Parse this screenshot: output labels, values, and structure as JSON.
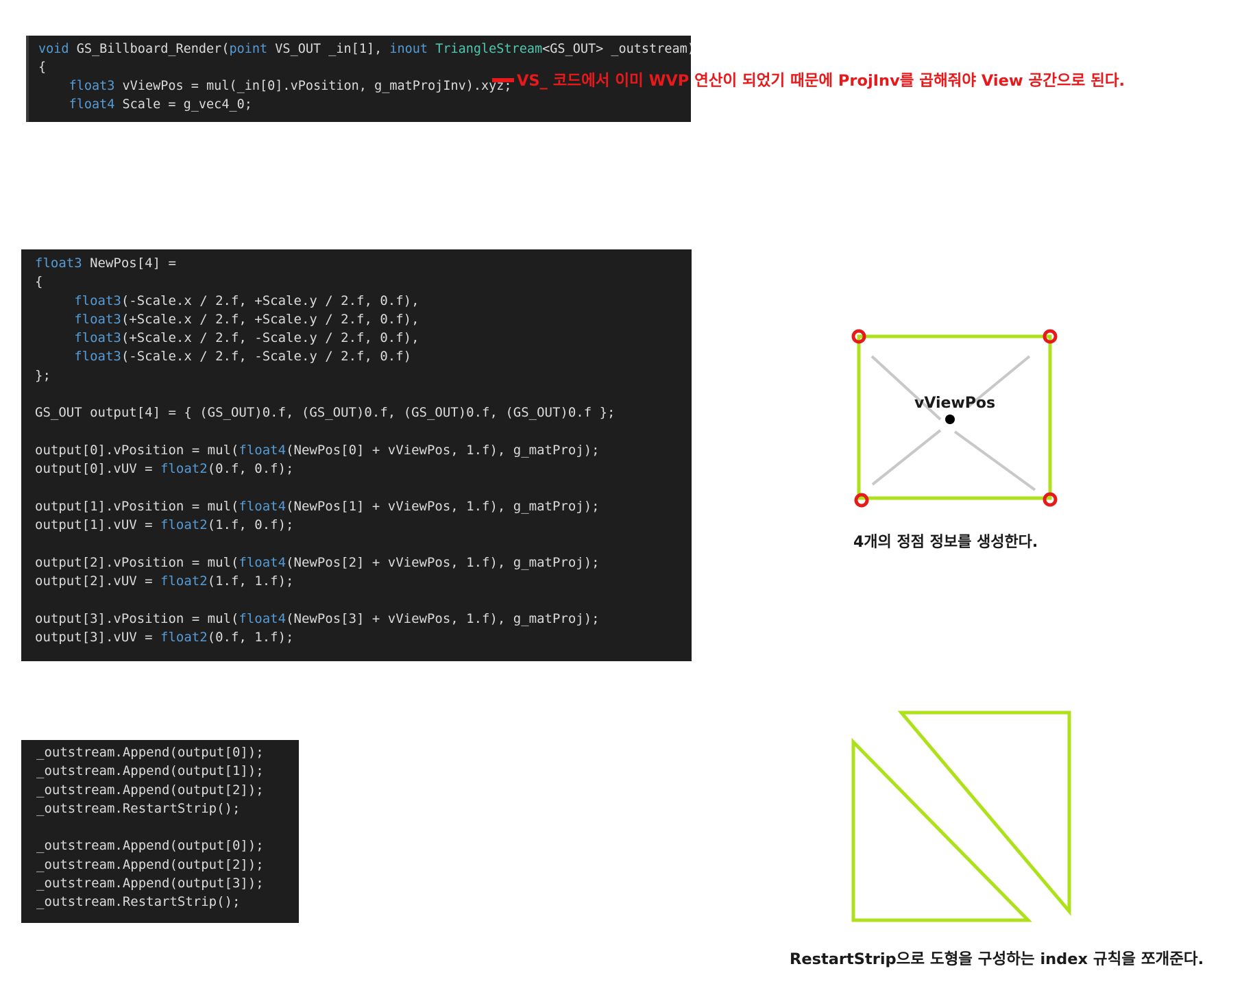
{
  "code_top": {
    "lines": [
      [
        {
          "t": "void ",
          "c": "kw"
        },
        {
          "t": "GS_Billboard_Render(",
          "c": ""
        },
        {
          "t": "point ",
          "c": "kw"
        },
        {
          "t": "VS_OUT _in[1], ",
          "c": ""
        },
        {
          "t": "inout ",
          "c": "kw"
        },
        {
          "t": "TriangleStream",
          "c": "ty"
        },
        {
          "t": "<GS_OUT> _outstream)",
          "c": ""
        }
      ],
      [
        {
          "t": "{",
          "c": ""
        }
      ],
      [
        {
          "t": "    ",
          "c": ""
        },
        {
          "t": "float3 ",
          "c": "kw"
        },
        {
          "t": "vViewPos = mul(_in[0].vPosition, g_matProjInv).xyz;",
          "c": ""
        }
      ],
      [
        {
          "t": "    ",
          "c": ""
        },
        {
          "t": "float4 ",
          "c": "kw"
        },
        {
          "t": "Scale = g_vec4_0;",
          "c": ""
        }
      ]
    ]
  },
  "code_middle": {
    "lines": [
      [
        {
          "t": "float3 ",
          "c": "kw"
        },
        {
          "t": "NewPos[4] =",
          "c": ""
        }
      ],
      [
        {
          "t": "{",
          "c": ""
        }
      ],
      [
        {
          "t": "     ",
          "c": ""
        },
        {
          "t": "float3",
          "c": "kw"
        },
        {
          "t": "(-Scale.x / 2.f, +Scale.y / 2.f, 0.f),",
          "c": ""
        }
      ],
      [
        {
          "t": "     ",
          "c": ""
        },
        {
          "t": "float3",
          "c": "kw"
        },
        {
          "t": "(+Scale.x / 2.f, +Scale.y / 2.f, 0.f),",
          "c": ""
        }
      ],
      [
        {
          "t": "     ",
          "c": ""
        },
        {
          "t": "float3",
          "c": "kw"
        },
        {
          "t": "(+Scale.x / 2.f, -Scale.y / 2.f, 0.f),",
          "c": ""
        }
      ],
      [
        {
          "t": "     ",
          "c": ""
        },
        {
          "t": "float3",
          "c": "kw"
        },
        {
          "t": "(-Scale.x / 2.f, -Scale.y / 2.f, 0.f)",
          "c": ""
        }
      ],
      [
        {
          "t": "};",
          "c": ""
        }
      ],
      [],
      [
        {
          "t": "GS_OUT output[4] = { (GS_OUT)0.f, (GS_OUT)0.f, (GS_OUT)0.f, (GS_OUT)0.f };",
          "c": ""
        }
      ],
      [],
      [
        {
          "t": "output[0].vPosition = mul(",
          "c": ""
        },
        {
          "t": "float4",
          "c": "kw"
        },
        {
          "t": "(NewPos[0] + vViewPos, 1.f), g_matProj);",
          "c": ""
        }
      ],
      [
        {
          "t": "output[0].vUV = ",
          "c": ""
        },
        {
          "t": "float2",
          "c": "kw"
        },
        {
          "t": "(0.f, 0.f);",
          "c": ""
        }
      ],
      [],
      [
        {
          "t": "output[1].vPosition = mul(",
          "c": ""
        },
        {
          "t": "float4",
          "c": "kw"
        },
        {
          "t": "(NewPos[1] + vViewPos, 1.f), g_matProj);",
          "c": ""
        }
      ],
      [
        {
          "t": "output[1].vUV = ",
          "c": ""
        },
        {
          "t": "float2",
          "c": "kw"
        },
        {
          "t": "(1.f, 0.f);",
          "c": ""
        }
      ],
      [],
      [
        {
          "t": "output[2].vPosition = mul(",
          "c": ""
        },
        {
          "t": "float4",
          "c": "kw"
        },
        {
          "t": "(NewPos[2] + vViewPos, 1.f), g_matProj);",
          "c": ""
        }
      ],
      [
        {
          "t": "output[2].vUV = ",
          "c": ""
        },
        {
          "t": "float2",
          "c": "kw"
        },
        {
          "t": "(1.f, 1.f);",
          "c": ""
        }
      ],
      [],
      [
        {
          "t": "output[3].vPosition = mul(",
          "c": ""
        },
        {
          "t": "float4",
          "c": "kw"
        },
        {
          "t": "(NewPos[3] + vViewPos, 1.f), g_matProj);",
          "c": ""
        }
      ],
      [
        {
          "t": "output[3].vUV = ",
          "c": ""
        },
        {
          "t": "float2",
          "c": "kw"
        },
        {
          "t": "(0.f, 1.f);",
          "c": ""
        }
      ]
    ]
  },
  "code_bottom": {
    "lines": [
      [
        {
          "t": "_outstream.Append(output[0]);",
          "c": ""
        }
      ],
      [
        {
          "t": "_outstream.Append(output[1]);",
          "c": ""
        }
      ],
      [
        {
          "t": "_outstream.Append(output[2]);",
          "c": ""
        }
      ],
      [
        {
          "t": "_outstream.RestartStrip();",
          "c": ""
        }
      ],
      [],
      [
        {
          "t": "_outstream.Append(output[0]);",
          "c": ""
        }
      ],
      [
        {
          "t": "_outstream.Append(output[2]);",
          "c": ""
        }
      ],
      [
        {
          "t": "_outstream.Append(output[3]);",
          "c": ""
        }
      ],
      [
        {
          "t": "_outstream.RestartStrip();",
          "c": ""
        }
      ]
    ]
  },
  "annotations": {
    "top": "VS_ 코드에서 이미 WVP 연산이 되었기 때문에 ProjInv를 곱해줘야 View 공간으로 된다.",
    "quad_caption": "4개의 정점 정보를 생성한다.",
    "vviewpos_label": "vViewPos",
    "strip_caption": "RestartStrip으로 도형을 구성하는 index 규칙을 쪼개준다."
  },
  "colors": {
    "code_bg": "#1e1e1e",
    "code_text": "#dcdcdc",
    "keyword": "#569cd6",
    "annotation_red": "#e8191b",
    "shape_green": "#aee11c",
    "vertex_red": "#e51b1b",
    "diagonal_gray": "#c8c8c8"
  }
}
